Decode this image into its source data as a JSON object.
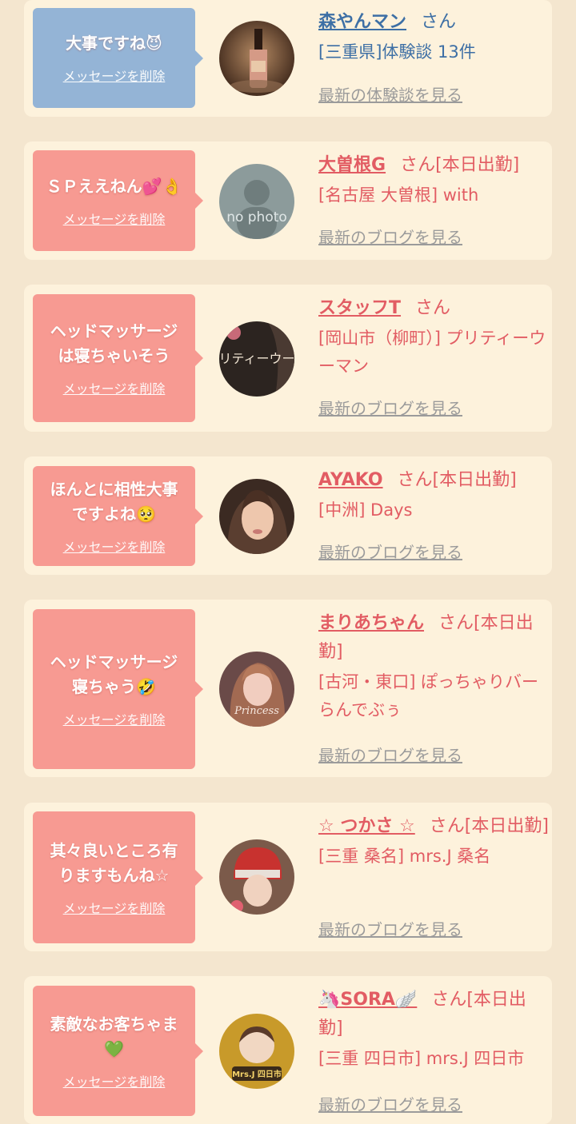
{
  "cards": [
    {
      "bubble_text": "大事ですね😈",
      "delete_label": "メッセージを削除",
      "name": "森やんマン",
      "suffix": "さん",
      "shop": "[三重県]体験談 13件",
      "more": "最新の体験談を見る",
      "color": "blue"
    },
    {
      "bubble_text": "ＳＰええねん💕👌",
      "delete_label": "メッセージを削除",
      "name": "大曽根G",
      "suffix": "さん[本日出勤]",
      "shop": "[名古屋 大曽根] with",
      "more": "最新のブログを見る",
      "avatar_text": "no photo",
      "color": "pink"
    },
    {
      "bubble_text": "ヘッドマッサージ\nは寝ちゃいそう",
      "delete_label": "メッセージを削除",
      "name": "スタッフT",
      "suffix": "さん",
      "shop": "[岡山市（柳町）] プリティーウーマン",
      "more": "最新のブログを見る",
      "avatar_text": "プリティーウーマ",
      "color": "pink"
    },
    {
      "bubble_text": "ほんとに相性大事\nですよね🥺",
      "delete_label": "メッセージを削除",
      "name": "AYAKO",
      "suffix": "さん[本日出勤]",
      "shop": "[中洲] Days",
      "more": "最新のブログを見る",
      "color": "pink"
    },
    {
      "bubble_text": "ヘッドマッサージ\n寝ちゃう🤣",
      "delete_label": "メッセージを削除",
      "name": "まりあちゃん",
      "suffix": "さん[本日出勤]",
      "shop": "[古河・東口] ぽっちゃりバー らんでぶぅ",
      "more": "最新のブログを見る",
      "avatar_text": "Princess",
      "color": "pink"
    },
    {
      "bubble_text": "其々良いところ有\nりますもんね☆",
      "delete_label": "メッセージを削除",
      "name": "☆ つかさ ☆",
      "suffix": "さん[本日出勤]",
      "shop": "[三重 桑名] mrs.J 桑名",
      "more": "最新のブログを見る",
      "color": "pink"
    },
    {
      "bubble_text": "素敵なお客ちゃま\n💚",
      "delete_label": "メッセージを削除",
      "name": "🦄SORA🪽",
      "suffix": "さん[本日出勤]",
      "shop": "[三重 四日市] mrs.J 四日市",
      "more": "最新のブログを見る",
      "avatar_text": "Mrs.J 四日市",
      "color": "pink"
    }
  ]
}
